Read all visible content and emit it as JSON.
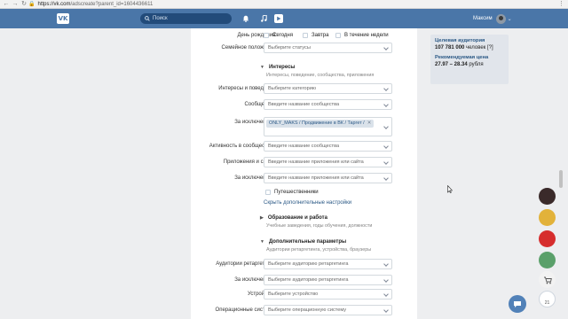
{
  "browser": {
    "url_host": "https://vk.com",
    "url_path": "/adscreate?parent_id=1604436611"
  },
  "header": {
    "search_placeholder": "Поиск",
    "user_name": "Максим"
  },
  "form": {
    "birthday": {
      "label": "День рождения:",
      "options": [
        "Сегодня",
        "Завтра",
        "В течение недели"
      ]
    },
    "family": {
      "label": "Семейное положение:",
      "placeholder": "Выберите статусы"
    },
    "interests_section": {
      "title": "Интересы",
      "subtitle": "Интересы, поведение, сообщества, приложения"
    },
    "interests": {
      "label": "Интересы и поведение:",
      "placeholder": "Выберите категорию"
    },
    "communities": {
      "label": "Сообщества:",
      "placeholder": "Введите название сообщества"
    },
    "communities_exclude": {
      "label": "За исключением:",
      "tag": "ONLY_MAKS / Продвижение в ВК / Таргет /"
    },
    "activity": {
      "label": "Активность в сообществах:",
      "placeholder": "Введите название сообщества"
    },
    "apps": {
      "label": "Приложения и сайты:",
      "placeholder": "Введите название приложения или сайта"
    },
    "apps_exclude": {
      "label": "За исключением:",
      "placeholder": "Введите название приложения или сайта"
    },
    "travelers": "Путешественники",
    "hide_link": "Скрыть дополнительные настройки",
    "education_section": {
      "title": "Образование и работа",
      "subtitle": "Учебные заведения, годы обучения, должности"
    },
    "extra_section": {
      "title": "Дополнительные параметры",
      "subtitle": "Аудитории ретаргетинга, устройства, браузеры"
    },
    "retargeting": {
      "label": "Аудитории ретаргетинга:",
      "placeholder": "Выберите аудиторию ретаргетинга"
    },
    "retargeting_exclude": {
      "label": "За исключением:",
      "placeholder": "Выберите аудиторию ретаргетинга"
    },
    "devices": {
      "label": "Устройства:",
      "placeholder": "Выберите устройство"
    },
    "os": {
      "label": "Операционные системы:",
      "placeholder": "Выберите операционную систему"
    }
  },
  "audience": {
    "target_title": "Целевая аудитория",
    "target_value": "107 781 000",
    "target_suffix": "человек [?]",
    "price_title": "Рекомендуемая цена",
    "price_value": "27.97 – 28.34",
    "price_suffix": "рубля"
  },
  "right_widgets": {
    "badge": "21",
    "colors": [
      "#3a2a2a",
      "#e2b23a",
      "#d62d2d",
      "#5aa06a",
      "#f2f2f2"
    ]
  }
}
